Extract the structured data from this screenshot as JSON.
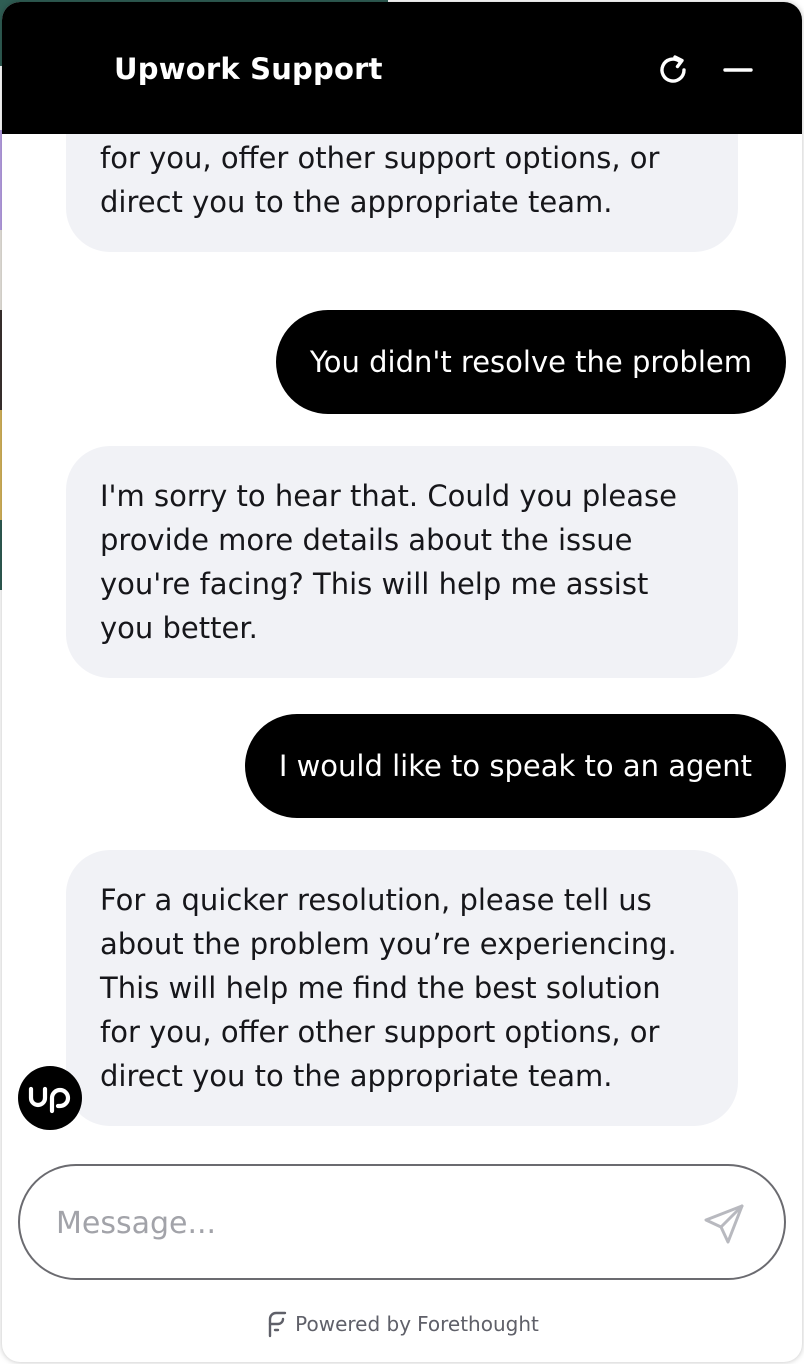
{
  "header": {
    "title": "Upwork Support",
    "refresh_icon": "refresh-icon",
    "minimize_icon": "minimize-icon"
  },
  "messages": [
    {
      "role": "bot",
      "text": "This will help me find the best solution for you, offer other support options, or direct you to the appropriate team."
    },
    {
      "role": "user",
      "text": "You didn't resolve the problem"
    },
    {
      "role": "bot",
      "text": "I'm sorry to hear that. Could you please provide more details about the issue you're facing? This will help me assist you better."
    },
    {
      "role": "user",
      "text": "I would like to speak to an agent"
    },
    {
      "role": "bot",
      "text": "For a quicker resolution, please tell us about the problem you’re experiencing. This will help me find the best solution for you, offer other support options, or direct you to the appropriate team."
    }
  ],
  "avatar": {
    "label": "up"
  },
  "composer": {
    "placeholder": "Message...",
    "value": "",
    "send_icon": "send-icon"
  },
  "footer": {
    "prefix": "Powered by",
    "brand": "Forethought"
  },
  "colors": {
    "header_bg": "#000000",
    "bot_bubble": "#f1f2f6",
    "user_bubble": "#000000"
  }
}
